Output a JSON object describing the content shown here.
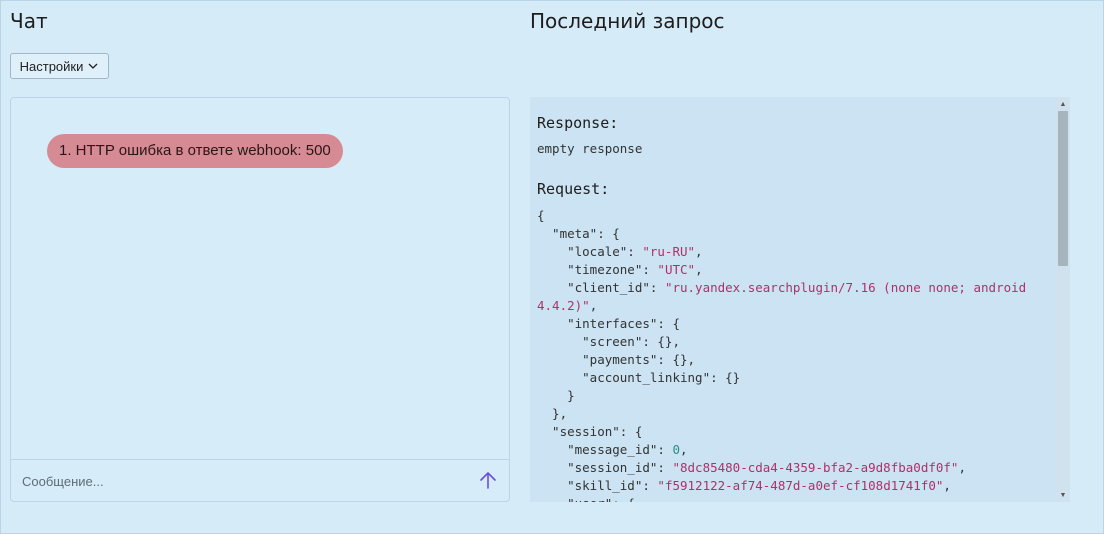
{
  "chat": {
    "title": "Чат",
    "settings_label": "Настройки",
    "messages": [
      {
        "text": "1. HTTP ошибка в ответе webhook: 500",
        "kind": "error",
        "color": "#d68b94"
      }
    ],
    "input_placeholder": "Сообщение...",
    "send_icon": "arrow-up-icon",
    "accent_color": "#6b4fd8"
  },
  "last_request": {
    "title": "Последний запрос",
    "response_label": "Response:",
    "response_value": "empty response",
    "request_label": "Request:",
    "request_lines": [
      "{",
      "  \"meta\": {",
      "    \"locale\": \"ru-RU\",",
      "    \"timezone\": \"UTC\",",
      "    \"client_id\": \"ru.yandex.searchplugin/7.16 (none none; android",
      "4.4.2)\",",
      "    \"interfaces\": {",
      "      \"screen\": {},",
      "      \"payments\": {},",
      "      \"account_linking\": {}",
      "    }",
      "  },",
      "  \"session\": {",
      "    \"message_id\": 0,",
      "    \"session_id\": \"8dc85480-cda4-4359-bfa2-a9d8fba0df0f\",",
      "    \"skill_id\": \"f5912122-af74-487d-a0ef-cf108d1741f0\",",
      "    \"user\": {"
    ]
  }
}
